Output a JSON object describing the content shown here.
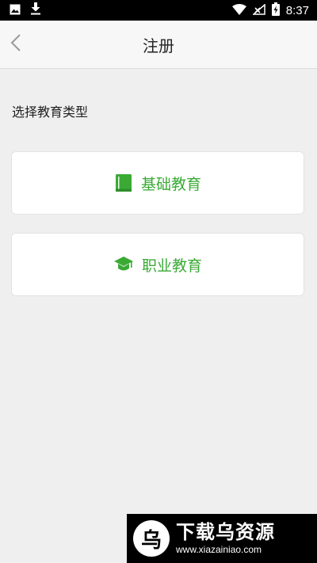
{
  "status_bar": {
    "time": "8:37",
    "icons": [
      "image-icon",
      "download-icon",
      "wifi-icon",
      "no-signal-icon",
      "battery-charging-icon"
    ]
  },
  "app_bar": {
    "title": "注册",
    "back_icon": "chevron-left-icon"
  },
  "main": {
    "section_label": "选择教育类型",
    "options": [
      {
        "label": "基础教育",
        "icon": "book-icon"
      },
      {
        "label": "职业教育",
        "icon": "graduation-cap-icon"
      }
    ]
  },
  "watermark": {
    "logo_char": "乌",
    "title": "下载乌资源",
    "url": "www.xiazainiao.com"
  },
  "colors": {
    "accent": "#3aaa35",
    "background": "#efefef",
    "card": "#ffffff",
    "status_bar": "#000000"
  }
}
